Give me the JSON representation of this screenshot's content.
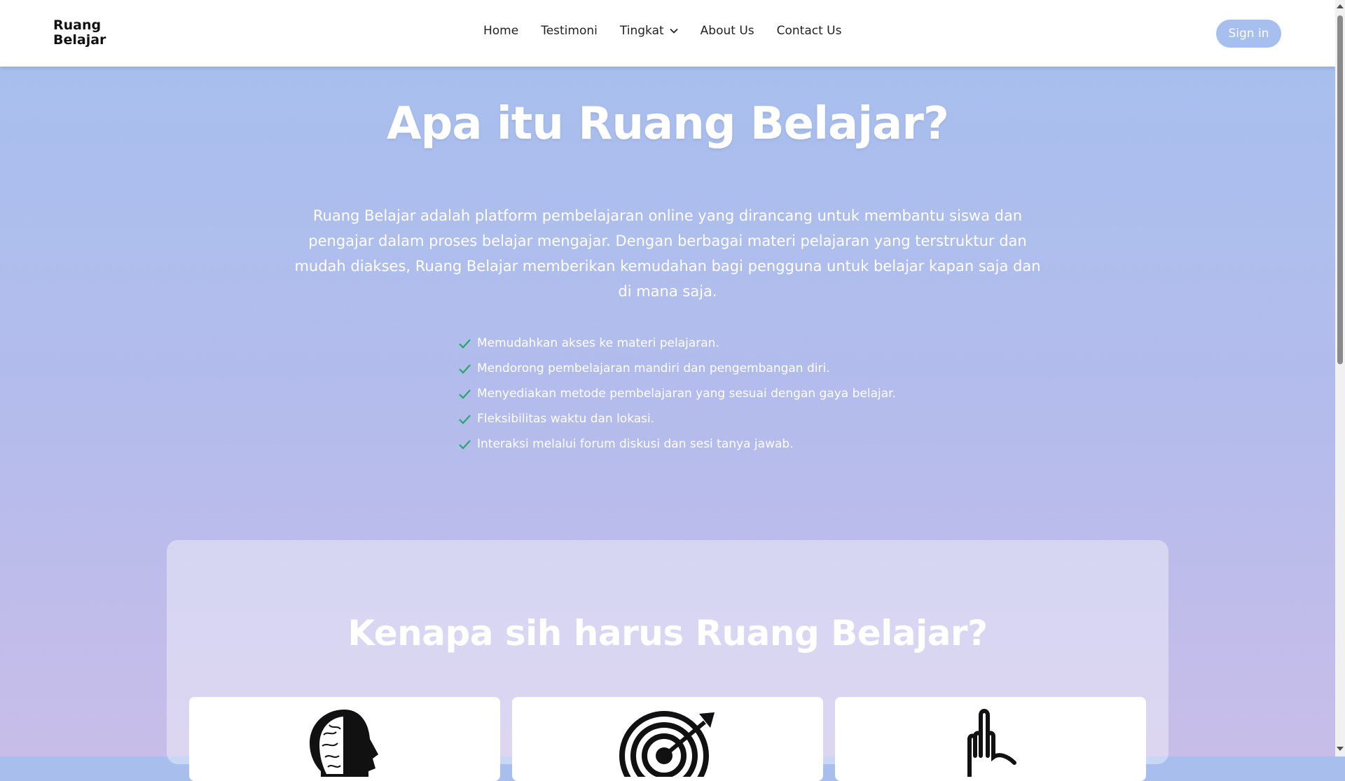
{
  "brand": {
    "line1": "Ruang",
    "line2": "Belajar"
  },
  "nav": {
    "items": [
      {
        "label": "Home"
      },
      {
        "label": "Testimoni"
      },
      {
        "label": "Tingkat",
        "has_dropdown": true
      },
      {
        "label": "About Us"
      },
      {
        "label": "Contact Us"
      }
    ],
    "signin_label": "Sign in"
  },
  "hero": {
    "title": "Apa itu Ruang Belajar?",
    "description": "Ruang Belajar adalah platform pembelajaran online yang dirancang untuk membantu siswa dan pengajar dalam proses belajar mengajar. Dengan berbagai materi pelajaran yang terstruktur dan mudah diakses, Ruang Belajar memberikan kemudahan bagi pengguna untuk belajar kapan saja dan di mana saja.",
    "benefits": [
      "Memudahkan akses ke materi pelajaran.",
      "Mendorong pembelajaran mandiri dan pengembangan diri.",
      "Menyediakan metode pembelajaran yang sesuai dengan gaya belajar.",
      "Fleksibilitas waktu dan lokasi.",
      "Interaksi melalui forum diskusi dan sesi tanya jawab."
    ]
  },
  "why": {
    "title": "Kenapa sih harus Ruang Belajar?",
    "cards": [
      {
        "icon": "brain-head-icon"
      },
      {
        "icon": "target-arrow-icon"
      },
      {
        "icon": "hand-gesture-icon"
      }
    ]
  },
  "colors": {
    "accent": "#a6bfee",
    "check": "#22a86b",
    "hero_top": "#a8bfee",
    "hero_bottom": "#c8bde9"
  }
}
